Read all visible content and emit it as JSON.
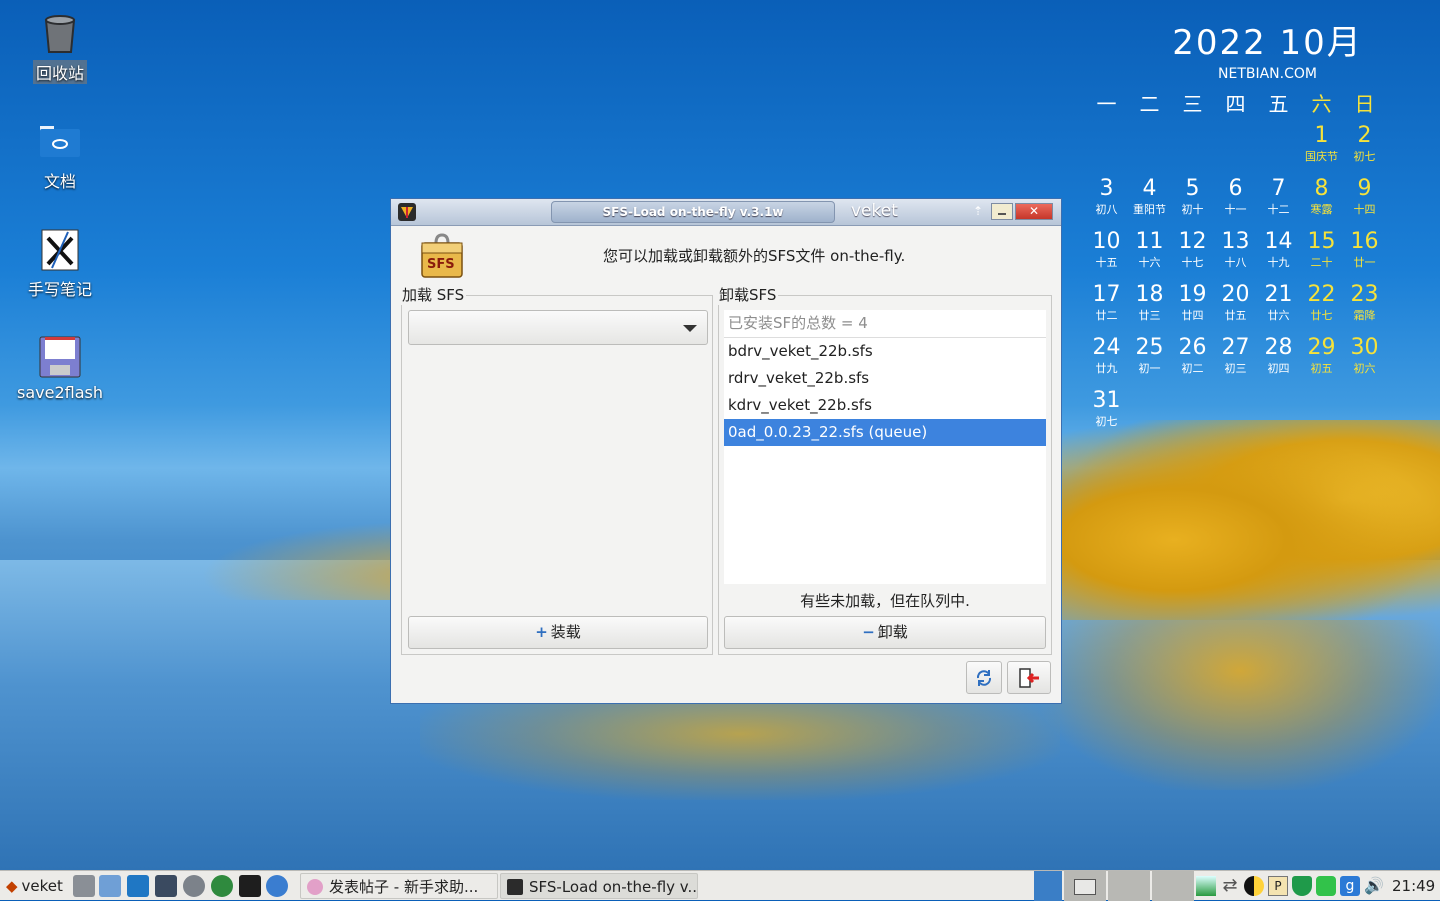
{
  "desktop": {
    "icons": [
      {
        "label": "回收站"
      },
      {
        "label": "文档"
      },
      {
        "label": "手写笔记"
      },
      {
        "label": "save2flash"
      }
    ]
  },
  "calendar": {
    "year_month": "2022  10月",
    "site": "NETBIAN.COM",
    "weekdays": [
      "一",
      "二",
      "三",
      "四",
      "五",
      "六",
      "日"
    ],
    "weeks": [
      [
        null,
        null,
        null,
        null,
        null,
        {
          "d": "1",
          "l": "国庆节"
        },
        {
          "d": "2",
          "l": "初七"
        }
      ],
      [
        {
          "d": "3",
          "l": "初八"
        },
        {
          "d": "4",
          "l": "重阳节"
        },
        {
          "d": "5",
          "l": "初十"
        },
        {
          "d": "6",
          "l": "十一"
        },
        {
          "d": "7",
          "l": "十二"
        },
        {
          "d": "8",
          "l": "寒露"
        },
        {
          "d": "9",
          "l": "十四"
        }
      ],
      [
        {
          "d": "10",
          "l": "十五"
        },
        {
          "d": "11",
          "l": "十六"
        },
        {
          "d": "12",
          "l": "十七"
        },
        {
          "d": "13",
          "l": "十八"
        },
        {
          "d": "14",
          "l": "十九"
        },
        {
          "d": "15",
          "l": "二十"
        },
        {
          "d": "16",
          "l": "廿一"
        }
      ],
      [
        {
          "d": "17",
          "l": "廿二"
        },
        {
          "d": "18",
          "l": "廿三"
        },
        {
          "d": "19",
          "l": "廿四"
        },
        {
          "d": "20",
          "l": "廿五"
        },
        {
          "d": "21",
          "l": "廿六"
        },
        {
          "d": "22",
          "l": "廿七"
        },
        {
          "d": "23",
          "l": "霜降"
        }
      ],
      [
        {
          "d": "24",
          "l": "廿九"
        },
        {
          "d": "25",
          "l": "初一"
        },
        {
          "d": "26",
          "l": "初二"
        },
        {
          "d": "27",
          "l": "初三"
        },
        {
          "d": "28",
          "l": "初四"
        },
        {
          "d": "29",
          "l": "初五"
        },
        {
          "d": "30",
          "l": "初六"
        }
      ],
      [
        {
          "d": "31",
          "l": "初七"
        },
        null,
        null,
        null,
        null,
        null,
        null
      ]
    ],
    "weekend_color": "#f6e23a"
  },
  "window": {
    "title": "SFS-Load on-the-fly v.3.1w",
    "workspace_name": "veket",
    "up_glyph": "⇡",
    "close_glyph": "✕",
    "logo_text": "SFS",
    "message": "您可以加载或卸载额外的SFS文件 on-the-fly.",
    "load": {
      "legend": "加载 SFS",
      "combo_value": "",
      "button_icon": "+",
      "button_label": "装载"
    },
    "unload": {
      "legend": "卸载SFS",
      "list_header": "已安装SF的总数 = 4",
      "items": [
        {
          "label": "bdrv_veket_22b.sfs",
          "selected": false
        },
        {
          "label": "rdrv_veket_22b.sfs",
          "selected": false
        },
        {
          "label": "kdrv_veket_22b.sfs",
          "selected": false
        },
        {
          "label": "0ad_0.0.23_22.sfs (queue)",
          "selected": true
        }
      ],
      "status": "有些未加载，但在队列中.",
      "button_icon": "−",
      "button_label": "卸载"
    },
    "refresh_icon": "refresh-icon",
    "quit_icon": "exit-icon",
    "accent": "#3d83de"
  },
  "taskbar": {
    "menu_label": "veket",
    "tasks": [
      {
        "label": "发表帖子 - 新手求助..."
      },
      {
        "label": "SFS-Load on-the-fly v..."
      }
    ],
    "clock": "21:49"
  }
}
